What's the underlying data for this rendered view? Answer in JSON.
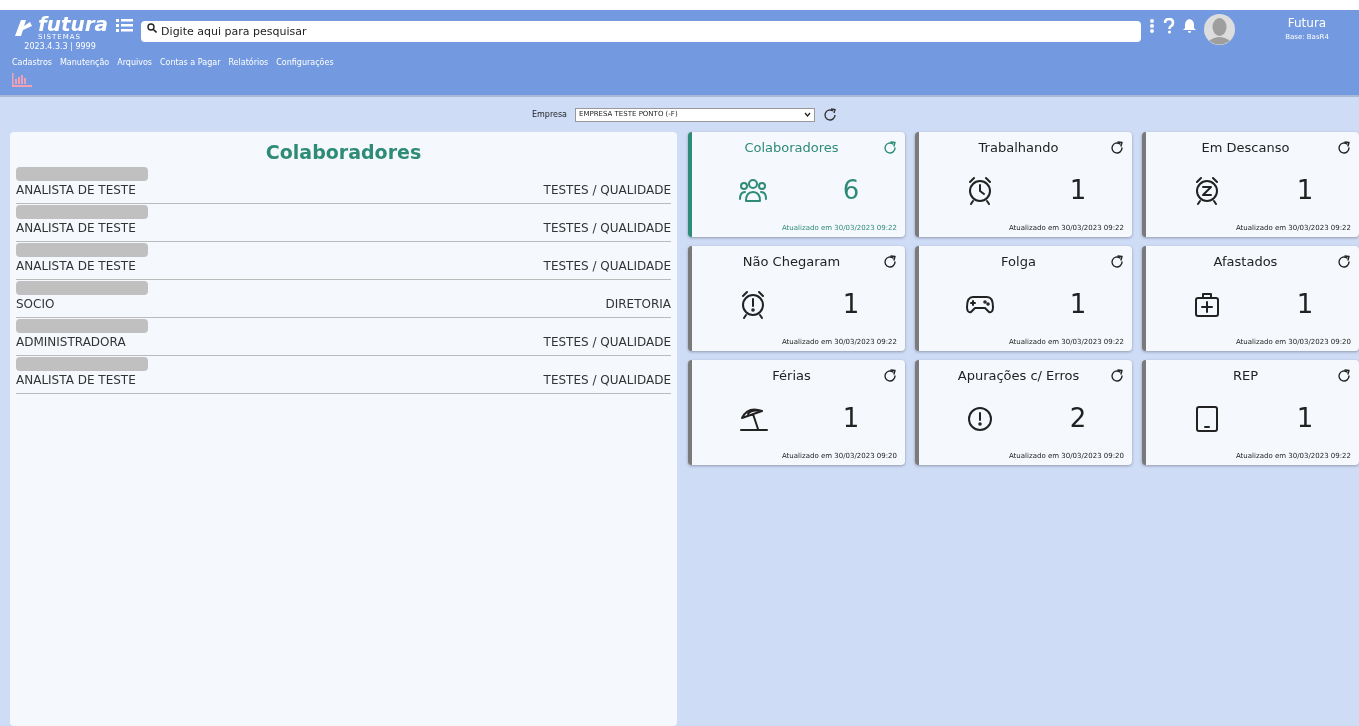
{
  "header": {
    "logo": {
      "text": "futura",
      "subtext": "SISTEMAS"
    },
    "version": "2023.4.3.3 | 9999",
    "search": {
      "placeholder": "Digite aqui para pesquisar"
    },
    "user": {
      "name": "Futura",
      "base": "Base: BasR4"
    },
    "menu": [
      "Cadastros",
      "Manutenção",
      "Arquivos",
      "Contas a Pagar",
      "Relatórios",
      "Configurações"
    ]
  },
  "filter": {
    "label": "Empresa",
    "value": "EMPRESA TESTE PONTO (-F)"
  },
  "list": {
    "title": "Colaboradores",
    "rows": [
      {
        "redacted": true,
        "role": "ANALISTA DE TESTE",
        "department": "TESTES / QUALIDADE"
      },
      {
        "redacted": true,
        "role": "ANALISTA DE TESTE",
        "department": "TESTES / QUALIDADE"
      },
      {
        "redacted": true,
        "role": "ANALISTA DE TESTE",
        "department": "TESTES / QUALIDADE"
      },
      {
        "redacted": true,
        "role": "SOCIO",
        "department": "DIRETORIA"
      },
      {
        "redacted": true,
        "role": "ADMINISTRADORA",
        "department": "TESTES / QUALIDADE"
      },
      {
        "redacted": true,
        "role": "ANALISTA DE TESTE",
        "department": "TESTES / QUALIDADE"
      }
    ]
  },
  "cards": [
    {
      "kind": "people",
      "title": "Colaboradores",
      "count": "6",
      "updated": "Atualizado em 30/03/2023 09:22",
      "selected": true
    },
    {
      "kind": "clock",
      "title": "Trabalhando",
      "count": "1",
      "updated": "Atualizado em 30/03/2023 09:22",
      "selected": false
    },
    {
      "kind": "snooze",
      "title": "Em Descanso",
      "count": "1",
      "updated": "Atualizado em 30/03/2023 09:22",
      "selected": false
    },
    {
      "kind": "alarm",
      "title": "Não Chegaram",
      "count": "1",
      "updated": "Atualizado em 30/03/2023 09:22",
      "selected": false
    },
    {
      "kind": "gamepad",
      "title": "Folga",
      "count": "1",
      "updated": "Atualizado em 30/03/2023 09:22",
      "selected": false
    },
    {
      "kind": "medkit",
      "title": "Afastados",
      "count": "1",
      "updated": "Atualizado em 30/03/2023 09:20",
      "selected": false
    },
    {
      "kind": "umbrella",
      "title": "Férias",
      "count": "1",
      "updated": "Atualizado em 30/03/2023 09:20",
      "selected": false
    },
    {
      "kind": "alert",
      "title": "Apurações c/ Erros",
      "count": "2",
      "updated": "Atualizado em 30/03/2023 09:20",
      "selected": false
    },
    {
      "kind": "tablet",
      "title": "REP",
      "count": "1",
      "updated": "Atualizado em 30/03/2023 09:22",
      "selected": false
    }
  ]
}
